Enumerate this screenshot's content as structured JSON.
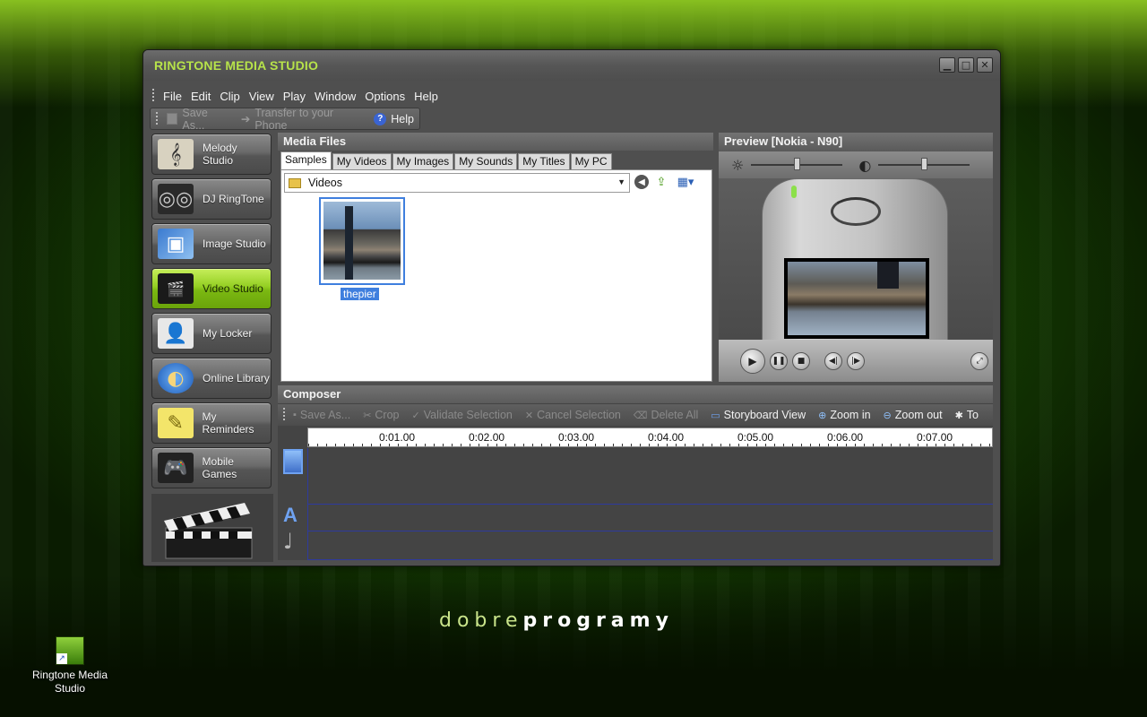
{
  "window": {
    "title": "RINGTONE MEDIA STUDIO",
    "controls": [
      "minimize",
      "maximize",
      "close"
    ]
  },
  "menubar": {
    "items": [
      "File",
      "Edit",
      "Clip",
      "View",
      "Play",
      "Window",
      "Options",
      "Help"
    ]
  },
  "toolbar": {
    "save_as": "Save As...",
    "transfer": "Transfer to your Phone",
    "help": "Help"
  },
  "sidebar": {
    "items": [
      {
        "label": "Melody Studio",
        "icon": "music-notes-icon"
      },
      {
        "label": "DJ RingTone",
        "icon": "turntable-icon"
      },
      {
        "label": "Image Studio",
        "icon": "photo-icon"
      },
      {
        "label": "Video Studio",
        "icon": "clapperboard-icon"
      },
      {
        "label": "My Locker",
        "icon": "person-icon"
      },
      {
        "label": "Online Library",
        "icon": "globe-icon"
      },
      {
        "label": "My Reminders",
        "icon": "note-icon"
      },
      {
        "label": "Mobile Games",
        "icon": "gamepad-icon"
      }
    ],
    "selected_index": 3
  },
  "media_files": {
    "title": "Media Files",
    "tabs": [
      "Samples",
      "My Videos",
      "My Images",
      "My Sounds",
      "My Titles",
      "My PC"
    ],
    "active_tab": "Samples",
    "folder": "Videos",
    "files": [
      {
        "name": "thepier",
        "selected": true
      }
    ]
  },
  "preview": {
    "title": "Preview [Nokia - N90]",
    "brightness_level": 0.5,
    "contrast_level": 0.5
  },
  "composer": {
    "title": "Composer",
    "toolbar": {
      "save_as": "Save As...",
      "crop": "Crop",
      "validate": "Validate Selection",
      "cancel": "Cancel Selection",
      "delete_all": "Delete All",
      "storyboard": "Storyboard View",
      "zoom_in": "Zoom in",
      "zoom_out": "Zoom out",
      "truncated": "To"
    },
    "timeline_ticks": [
      "0:01.00",
      "0:02.00",
      "0:03.00",
      "0:04.00",
      "0:05.00",
      "0:06.00",
      "0:07.00"
    ]
  },
  "desktop": {
    "logo_light": "dobre",
    "logo_bold": "programy",
    "icon_label": "Ringtone Media Studio"
  },
  "colors": {
    "accent": "#b7e34a",
    "selection": "#3f7fde",
    "nav_selected": "#94cf23"
  }
}
